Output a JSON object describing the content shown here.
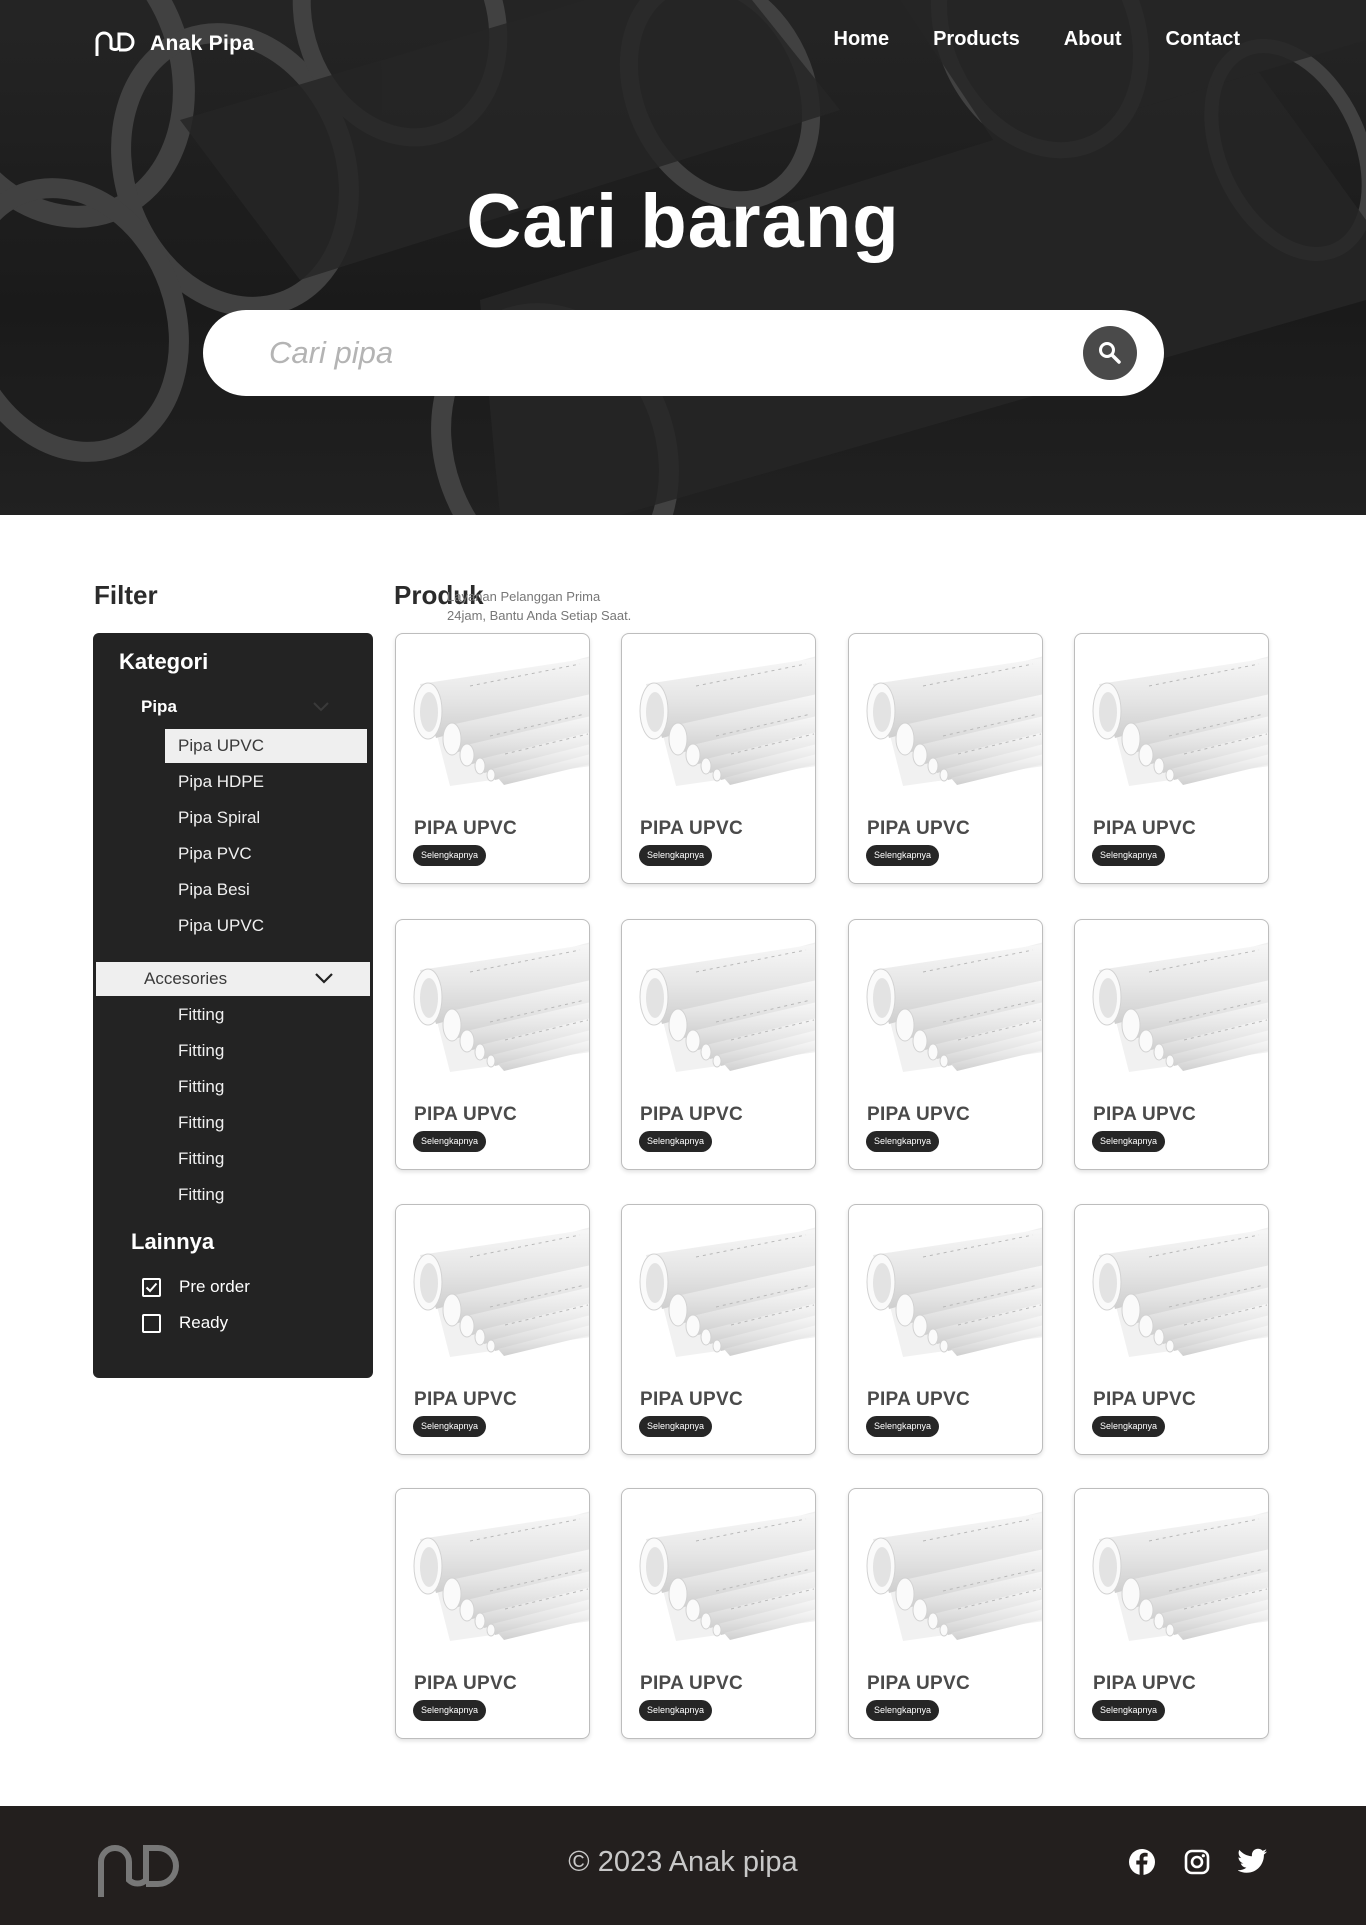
{
  "header": {
    "brand": "Anak Pipa",
    "nav": [
      "Home",
      "Products",
      "About",
      "Contact"
    ]
  },
  "hero": {
    "title": "Cari barang",
    "search_placeholder": "Cari pipa",
    "search_icon": "search-icon"
  },
  "filter": {
    "title": "Filter",
    "category_title": "Kategori",
    "pipe_group": "Pipa",
    "pipe_items": [
      "Pipa UPVC",
      "Pipa HDPE",
      "Pipa Spiral",
      "Pipa PVC",
      "Pipa Besi",
      "Pipa UPVC"
    ],
    "accessories_group": "Accesories",
    "accessory_items": [
      "Fitting",
      "Fitting",
      "Fitting",
      "Fitting",
      "Fitting",
      "Fitting"
    ],
    "other_title": "Lainnya",
    "options": [
      {
        "label": "Pre order",
        "checked": true
      },
      {
        "label": "Ready",
        "checked": false
      }
    ]
  },
  "products": {
    "title": "Produk",
    "note_line1": "Layanan Pelanggan Prima",
    "note_line2": "24jam, Bantu Anda Setiap Saat.",
    "button_label": "Selengkapnya",
    "items": [
      "PIPA UPVC",
      "PIPA UPVC",
      "PIPA UPVC",
      "PIPA UPVC",
      "PIPA UPVC",
      "PIPA UPVC",
      "PIPA UPVC",
      "PIPA UPVC",
      "PIPA UPVC",
      "PIPA UPVC",
      "PIPA UPVC",
      "PIPA UPVC",
      "PIPA UPVC",
      "PIPA UPVC",
      "PIPA UPVC",
      "PIPA UPVC"
    ]
  },
  "footer": {
    "copyright": "© 2023 Anak pipa",
    "social": [
      "facebook-icon",
      "instagram-icon",
      "twitter-icon"
    ]
  }
}
